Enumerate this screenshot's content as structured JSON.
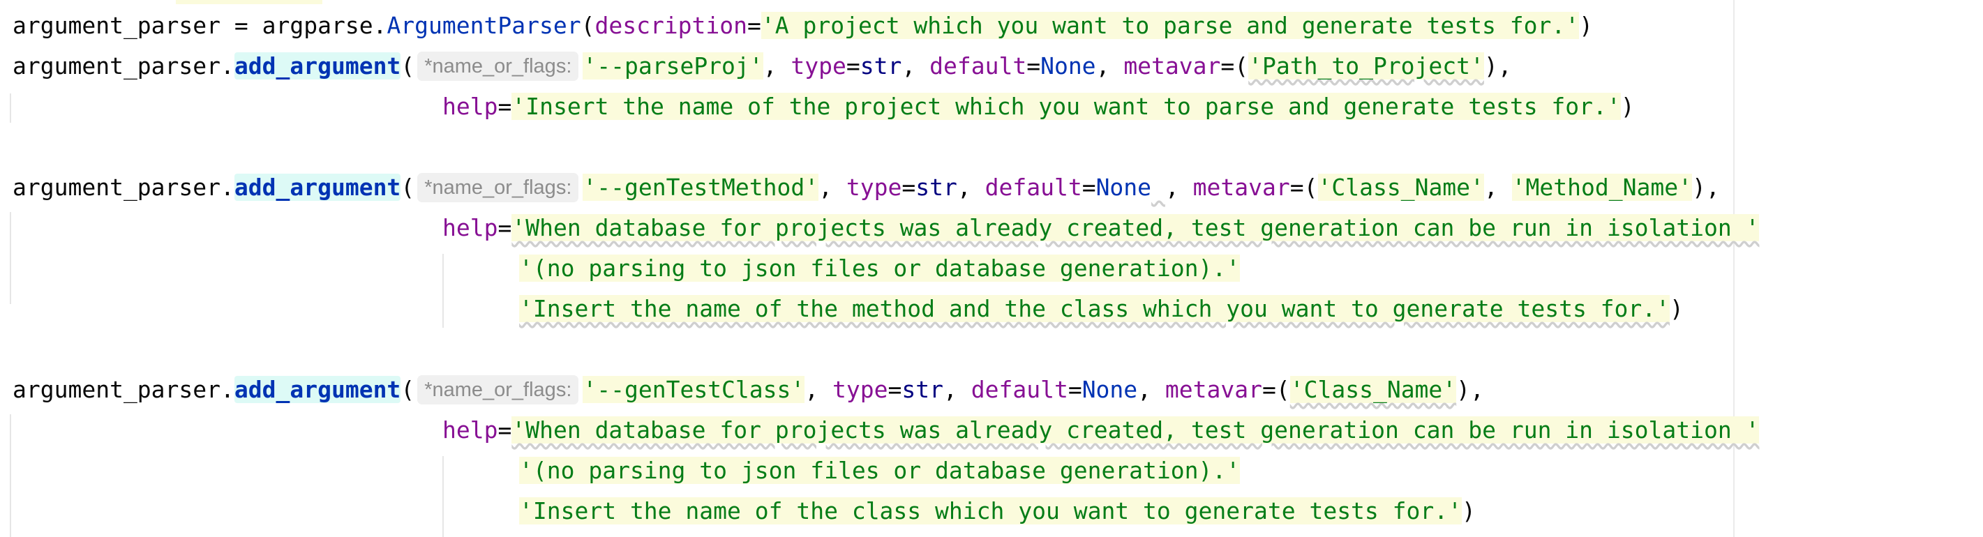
{
  "editor": {
    "lines": [
      {
        "parts": [
          {
            "text": "argument_parser = argparse."
          },
          {
            "text": "ArgumentParser",
            "cls": "fn"
          },
          {
            "text": "("
          },
          {
            "text": "description",
            "cls": "kw"
          },
          {
            "text": "="
          },
          {
            "text": "'A project which you want to parse and generate tests for.'",
            "cls": "str"
          },
          {
            "text": ")"
          }
        ]
      },
      {
        "parts": [
          {
            "text": "argument_parser."
          },
          {
            "text": "add_argument",
            "cls": "meth"
          },
          {
            "text": "("
          },
          {
            "hint": "*name_or_flags:"
          },
          {
            "text": "'--parseProj'",
            "cls": "str"
          },
          {
            "text": ", "
          },
          {
            "text": "type",
            "cls": "kw"
          },
          {
            "text": "="
          },
          {
            "text": "str",
            "cls": "builtin"
          },
          {
            "text": ", "
          },
          {
            "text": "default",
            "cls": "kw"
          },
          {
            "text": "="
          },
          {
            "text": "None",
            "cls": "none"
          },
          {
            "text": ", "
          },
          {
            "text": "metavar",
            "cls": "kw"
          },
          {
            "text": "=("
          },
          {
            "text": "'Path_to_Project'",
            "cls": "str dots"
          },
          {
            "text": "),"
          }
        ]
      },
      {
        "indent": "cont",
        "parts": [
          {
            "text": "help",
            "cls": "kw"
          },
          {
            "text": "="
          },
          {
            "text": "'Insert the name of the project which you want to parse and generate tests for.'",
            "cls": "str"
          },
          {
            "text": ")"
          }
        ]
      },
      {
        "parts": [
          {
            "text": "argument_parser."
          },
          {
            "text": "add_argument",
            "cls": "meth"
          },
          {
            "text": "("
          },
          {
            "hint": "*name_or_flags:"
          },
          {
            "text": "'--genTestMethod'",
            "cls": "str"
          },
          {
            "text": ", "
          },
          {
            "text": "type",
            "cls": "kw"
          },
          {
            "text": "="
          },
          {
            "text": "str",
            "cls": "builtin"
          },
          {
            "text": ", "
          },
          {
            "text": "default",
            "cls": "kw"
          },
          {
            "text": "="
          },
          {
            "text": "None",
            "cls": "none"
          },
          {
            "text": " ",
            "cls": "dots"
          },
          {
            "text": ", "
          },
          {
            "text": "metavar",
            "cls": "kw"
          },
          {
            "text": "=("
          },
          {
            "text": "'Class_Name'",
            "cls": "str"
          },
          {
            "text": ", "
          },
          {
            "text": "'Method_Name'",
            "cls": "str"
          },
          {
            "text": "),"
          }
        ]
      },
      {
        "indent": "cont",
        "parts": [
          {
            "text": "help",
            "cls": "kw"
          },
          {
            "text": "="
          },
          {
            "text": "'When database for projects was already created, test generation can be run in isolation '",
            "cls": "str dots"
          }
        ]
      },
      {
        "indent": "cont2",
        "parts": [
          {
            "text": "'(no parsing to json files or database generation).'",
            "cls": "str"
          }
        ]
      },
      {
        "indent": "cont2",
        "parts": [
          {
            "text": "'Insert the name of the method and the class which you want to generate tests for.'",
            "cls": "str dots"
          },
          {
            "text": ")"
          }
        ]
      },
      {
        "parts": [
          {
            "text": "argument_parser."
          },
          {
            "text": "add_argument",
            "cls": "meth"
          },
          {
            "text": "("
          },
          {
            "hint": "*name_or_flags:"
          },
          {
            "text": "'--genTestClass'",
            "cls": "str"
          },
          {
            "text": ", "
          },
          {
            "text": "type",
            "cls": "kw"
          },
          {
            "text": "="
          },
          {
            "text": "str",
            "cls": "builtin"
          },
          {
            "text": ", "
          },
          {
            "text": "default",
            "cls": "kw"
          },
          {
            "text": "="
          },
          {
            "text": "None",
            "cls": "none"
          },
          {
            "text": ", "
          },
          {
            "text": "metavar",
            "cls": "kw"
          },
          {
            "text": "=("
          },
          {
            "text": "'Class_Name'",
            "cls": "str dots"
          },
          {
            "text": "),"
          }
        ]
      },
      {
        "indent": "cont",
        "parts": [
          {
            "text": "help",
            "cls": "kw"
          },
          {
            "text": "="
          },
          {
            "text": "'When database for projects was already created, test generation can be run in isolation '",
            "cls": "str dots"
          }
        ]
      },
      {
        "indent": "cont2",
        "parts": [
          {
            "text": "'(no parsing to json files or database generation).'",
            "cls": "str"
          }
        ]
      },
      {
        "indent": "cont2",
        "parts": [
          {
            "text": "'Insert the name of the class which you want to generate tests for.'",
            "cls": "str"
          },
          {
            "text": ")"
          }
        ]
      }
    ]
  }
}
